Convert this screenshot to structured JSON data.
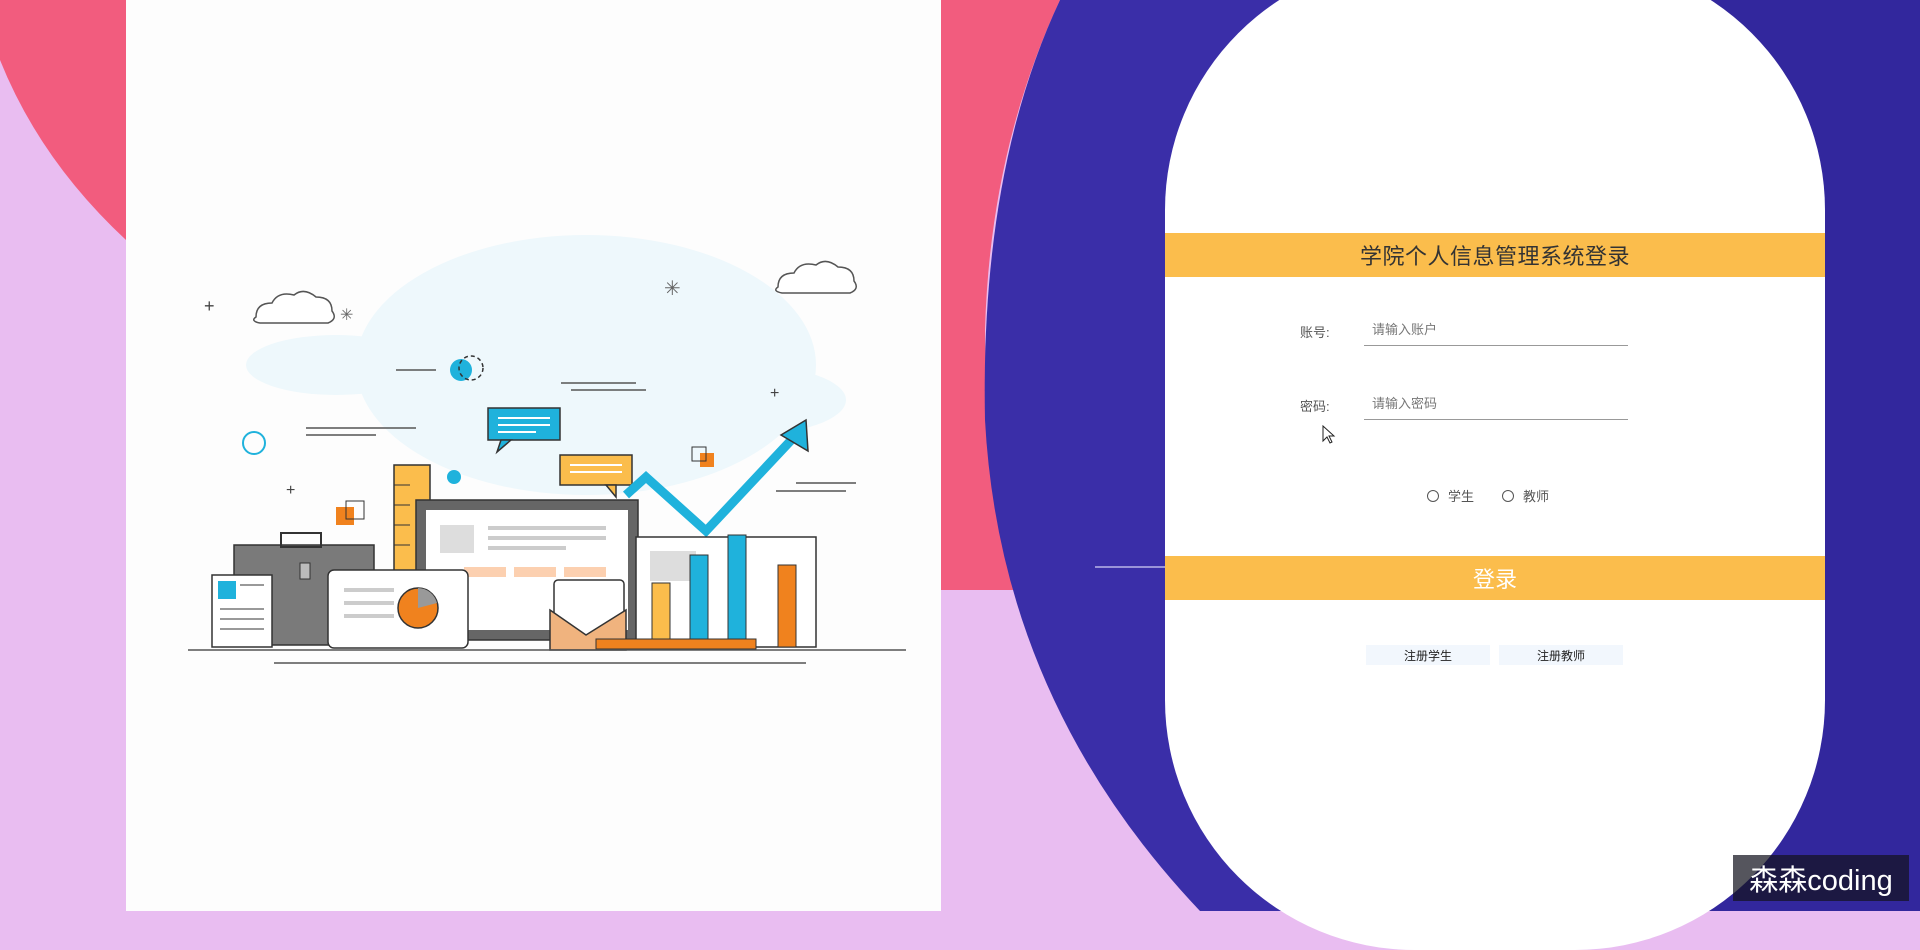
{
  "colors": {
    "accent": "#fbbd4c",
    "background_pink": "#e9bdf1",
    "background_red": "#f25c7e",
    "background_blue": "#3024a0",
    "card": "#ffffff",
    "chart_blue": "#1fb2dc",
    "chart_orange": "#f0821e"
  },
  "login": {
    "title": "学院个人信息管理系统登录",
    "account_label": "账号:",
    "account_placeholder": "请输入账户",
    "password_label": "密码:",
    "password_placeholder": "请输入密码",
    "roles": [
      {
        "label": "学生",
        "selected": false
      },
      {
        "label": "教师",
        "selected": false
      }
    ],
    "login_button": "登录",
    "register_student": "注册学生",
    "register_teacher": "注册教师"
  },
  "watermark": "森森coding",
  "illustration": {
    "icon": "business-growth-illustration"
  }
}
